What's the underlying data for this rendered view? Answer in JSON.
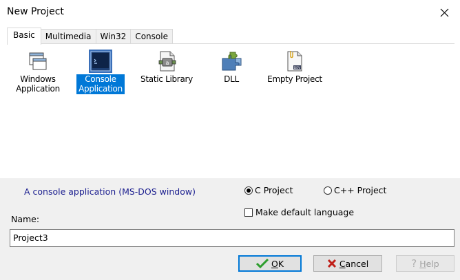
{
  "window": {
    "title": "New Project",
    "close_glyph": "✕"
  },
  "tabs": [
    {
      "label": "Basic",
      "active": true
    },
    {
      "label": "Multimedia",
      "active": false
    },
    {
      "label": "Win32",
      "active": false
    },
    {
      "label": "Console",
      "active": false
    }
  ],
  "templates": [
    {
      "label": "Windows Application",
      "icon": "windows-application-icon",
      "selected": false
    },
    {
      "label": "Console Application",
      "icon": "console-application-icon",
      "selected": true
    },
    {
      "label": "Static Library",
      "icon": "static-library-icon",
      "selected": false
    },
    {
      "label": "DLL",
      "icon": "dll-puzzle-icon",
      "selected": false
    },
    {
      "label": "Empty Project",
      "icon": "empty-project-icon",
      "selected": false
    }
  ],
  "description": "A console application (MS-DOS window)",
  "language": {
    "options": [
      {
        "label": "C Project",
        "checked": true
      },
      {
        "label": "C++ Project",
        "checked": false
      }
    ],
    "make_default_label": "Make default language",
    "make_default_checked": false
  },
  "name": {
    "label": "Name:",
    "value": "Project3"
  },
  "buttons": {
    "ok": {
      "mnemonic": "O",
      "rest": "K"
    },
    "cancel": {
      "mnemonic": "C",
      "rest": "ancel"
    },
    "help": {
      "mnemonic": "H",
      "rest": "elp"
    }
  },
  "colors": {
    "selection": "#0078d7",
    "description_text": "#1b1e8f",
    "ok_check": "#2e9e2e",
    "cancel_x": "#c0201a"
  }
}
